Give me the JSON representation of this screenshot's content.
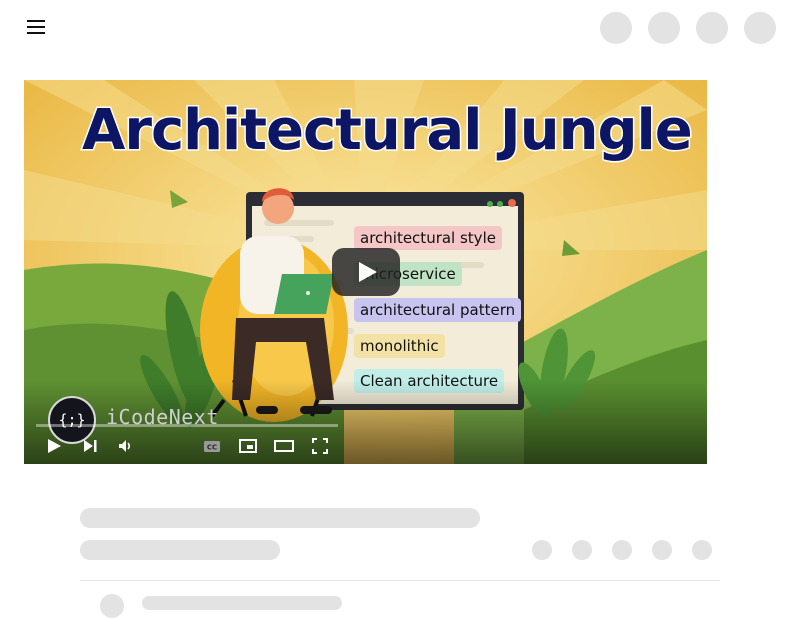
{
  "video": {
    "title": "Architectural Jungle",
    "tags": [
      {
        "label": "architectural style",
        "color": "#f4c6c6"
      },
      {
        "label": "microservice",
        "color": "#bfe3c4"
      },
      {
        "label": "architectural pattern",
        "color": "#c7c4ef"
      },
      {
        "label": "monolithic",
        "color": "#f3e2a6"
      },
      {
        "label": "Clean architecture",
        "color": "#c2eee8"
      }
    ],
    "channel": {
      "name": "iCodeNext",
      "avatar_text": "{;}"
    },
    "controls": [
      "play-icon",
      "next-icon",
      "volume-icon",
      "captions-icon",
      "miniplayer-icon",
      "theater-icon",
      "fullscreen-icon"
    ]
  },
  "colors": {
    "skeleton": "#e3e3e3",
    "title": "#0c1665",
    "sky": "#efc45a"
  }
}
